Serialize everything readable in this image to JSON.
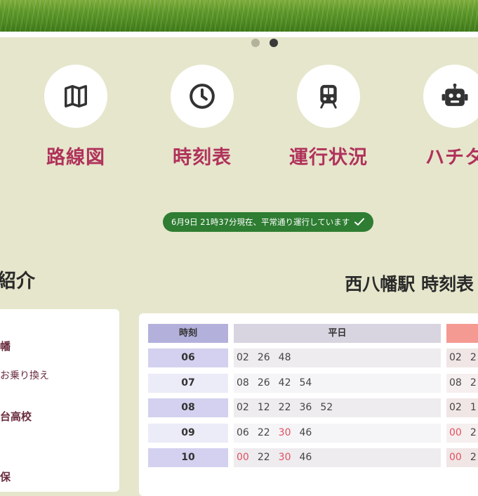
{
  "pager": {
    "count": 2,
    "active": 1
  },
  "menu": [
    {
      "label": "路線図",
      "icon": "map-icon"
    },
    {
      "label": "時刻表",
      "icon": "clock-icon"
    },
    {
      "label": "運行状況",
      "icon": "train-icon"
    },
    {
      "label": "ハチタ",
      "icon": "robot-icon"
    }
  ],
  "status": {
    "text": "6月9日 21時37分現在、平常通り運行しています",
    "icon": "check-icon",
    "color": "#2e7d32"
  },
  "left_section": {
    "title": "紹介",
    "items": [
      "幡",
      "お乗り換え",
      "台高校",
      "保"
    ]
  },
  "timetable": {
    "title": "西八幡駅 時刻表",
    "headers": {
      "hour": "時刻",
      "weekday": "平日"
    },
    "rows": [
      {
        "hour": "06",
        "weekday": [
          {
            "m": "02"
          },
          {
            "m": "26"
          },
          {
            "m": "48"
          }
        ],
        "holiday": [
          {
            "m": "02"
          },
          {
            "m": "2"
          }
        ]
      },
      {
        "hour": "07",
        "weekday": [
          {
            "m": "08"
          },
          {
            "m": "26"
          },
          {
            "m": "42"
          },
          {
            "m": "54"
          }
        ],
        "holiday": [
          {
            "m": "08"
          },
          {
            "m": "2"
          }
        ]
      },
      {
        "hour": "08",
        "weekday": [
          {
            "m": "02"
          },
          {
            "m": "12"
          },
          {
            "m": "22"
          },
          {
            "m": "36"
          },
          {
            "m": "52"
          }
        ],
        "holiday": [
          {
            "m": "02"
          },
          {
            "m": "1"
          }
        ]
      },
      {
        "hour": "09",
        "weekday": [
          {
            "m": "06"
          },
          {
            "m": "22"
          },
          {
            "m": "30",
            "red": true
          },
          {
            "m": "46"
          }
        ],
        "holiday": [
          {
            "m": "00",
            "red": true
          },
          {
            "m": "2"
          }
        ]
      },
      {
        "hour": "10",
        "weekday": [
          {
            "m": "00",
            "red": true
          },
          {
            "m": "22"
          },
          {
            "m": "30",
            "red": true
          },
          {
            "m": "46"
          }
        ],
        "holiday": [
          {
            "m": "00",
            "red": true
          },
          {
            "m": "2"
          }
        ]
      }
    ]
  },
  "colors": {
    "accent": "#b0325b",
    "background": "#e6e6cc",
    "hour_head": "#b3b1dc",
    "weekday_head": "#d8d4e0",
    "holiday_head": "#f49a92",
    "red_minute": "#e05060"
  }
}
